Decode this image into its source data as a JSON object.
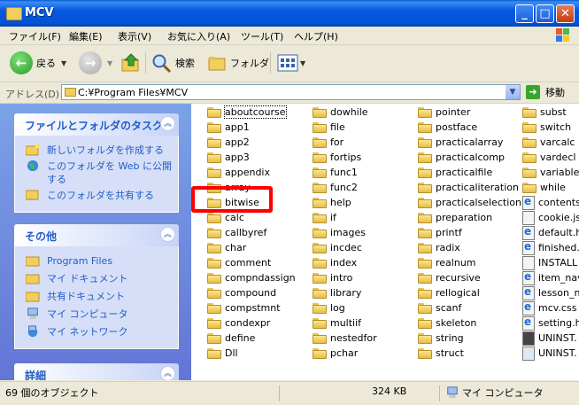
{
  "window": {
    "title": "MCV"
  },
  "menu": [
    "ファイル(F)",
    "編集(E)",
    "表示(V)",
    "お気に入り(A)",
    "ツール(T)",
    "ヘルプ(H)"
  ],
  "toolbar": {
    "back": "戻る",
    "search": "検索",
    "folders": "フォルダ"
  },
  "address": {
    "label": "アドレス(D)",
    "path": "C:¥Program Files¥MCV",
    "go": "移動"
  },
  "left_panel": {
    "tasks": {
      "title": "ファイルとフォルダのタスク",
      "items": [
        "新しいフォルダを作成する",
        "このフォルダを Web に公開する",
        "このフォルダを共有する"
      ]
    },
    "other": {
      "title": "その他",
      "items": [
        "Program Files",
        "マイ ドキュメント",
        "共有ドキュメント",
        "マイ コンピュータ",
        "マイ ネットワーク"
      ]
    },
    "details": {
      "title": "詳細"
    }
  },
  "files": {
    "col1": [
      "aboutcourse",
      "app1",
      "app2",
      "app3",
      "appendix",
      "array",
      "bitwise",
      "calc",
      "callbyref",
      "char",
      "comment",
      "compndassign",
      "compound",
      "compstmnt",
      "condexpr",
      "define",
      "Dll"
    ],
    "col2": [
      "dowhile",
      "file",
      "for",
      "fortips",
      "func1",
      "func2",
      "help",
      "if",
      "images",
      "incdec",
      "index",
      "intro",
      "library",
      "log",
      "multiif",
      "nestedfor",
      "pchar"
    ],
    "col3": [
      "pointer",
      "postface",
      "practicalarray",
      "practicalcomp",
      "practicalfile",
      "practicaliteration",
      "practicalselection",
      "preparation",
      "printf",
      "radix",
      "realnum",
      "recursive",
      "rellogical",
      "scanf",
      "skeleton",
      "string",
      "struct"
    ],
    "col4": [
      "subst",
      "switch",
      "varcalc",
      "vardecl",
      "variables",
      "while",
      "contents",
      "cookie.js",
      "default.h",
      "finished.l",
      "INSTALL",
      "item_nav",
      "lesson_n",
      "mcv.css",
      "setting.h",
      "UNINST.",
      "UNINST."
    ],
    "col4_types": [
      "folder",
      "folder",
      "folder",
      "folder",
      "folder",
      "folder",
      "ie",
      "doc",
      "ie",
      "ie",
      "doc",
      "ie",
      "ie",
      "ie",
      "ie",
      "dos",
      "cd"
    ]
  },
  "status": {
    "objects": "69 個のオブジェクト",
    "size": "324 KB",
    "location": "マイ コンピュータ"
  },
  "colors": {
    "accent": "#215dc6",
    "highlight": "#ff0000"
  }
}
